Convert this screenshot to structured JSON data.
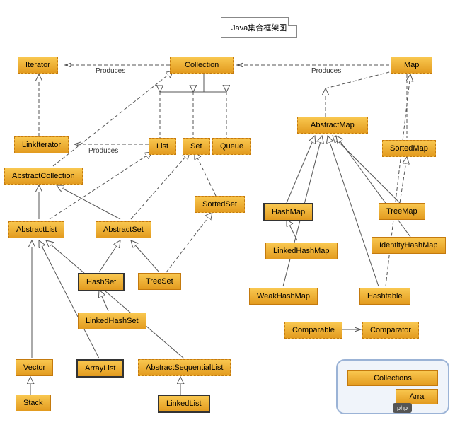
{
  "title": "Java集合框架图",
  "edges": {
    "produces1": "Produces",
    "produces2": "Produces",
    "produces3": "Produces"
  },
  "nodes": {
    "iterator": "Iterator",
    "collection": "Collection",
    "map": "Map",
    "linkIterator": "LinkIterator",
    "list": "List",
    "set": "Set",
    "queue": "Queue",
    "abstractMap": "AbstractMap",
    "sortedMap": "SortedMap",
    "abstractCollection": "AbstractCollection",
    "sortedSet": "SortedSet",
    "hashMap": "HashMap",
    "treeMap": "TreeMap",
    "abstractList": "AbstractList",
    "abstractSet": "AbstractSet",
    "identityHashMap": "IdentityHashMap",
    "linkedHashMap": "LinkedHashMap",
    "hashSet": "HashSet",
    "treeSet": "TreeSet",
    "weakHashMap": "WeakHashMap",
    "hashtable": "Hashtable",
    "linkedHashSet": "LinkedHashSet",
    "comparable": "Comparable",
    "comparator": "Comparator",
    "vector": "Vector",
    "arrayList": "ArrayList",
    "abstractSequentialList": "AbstractSequentialList",
    "stack": "Stack",
    "linkedList": "LinkedList"
  },
  "legend": {
    "collections": "Collections",
    "arrays": "Arra"
  },
  "badge": "php"
}
